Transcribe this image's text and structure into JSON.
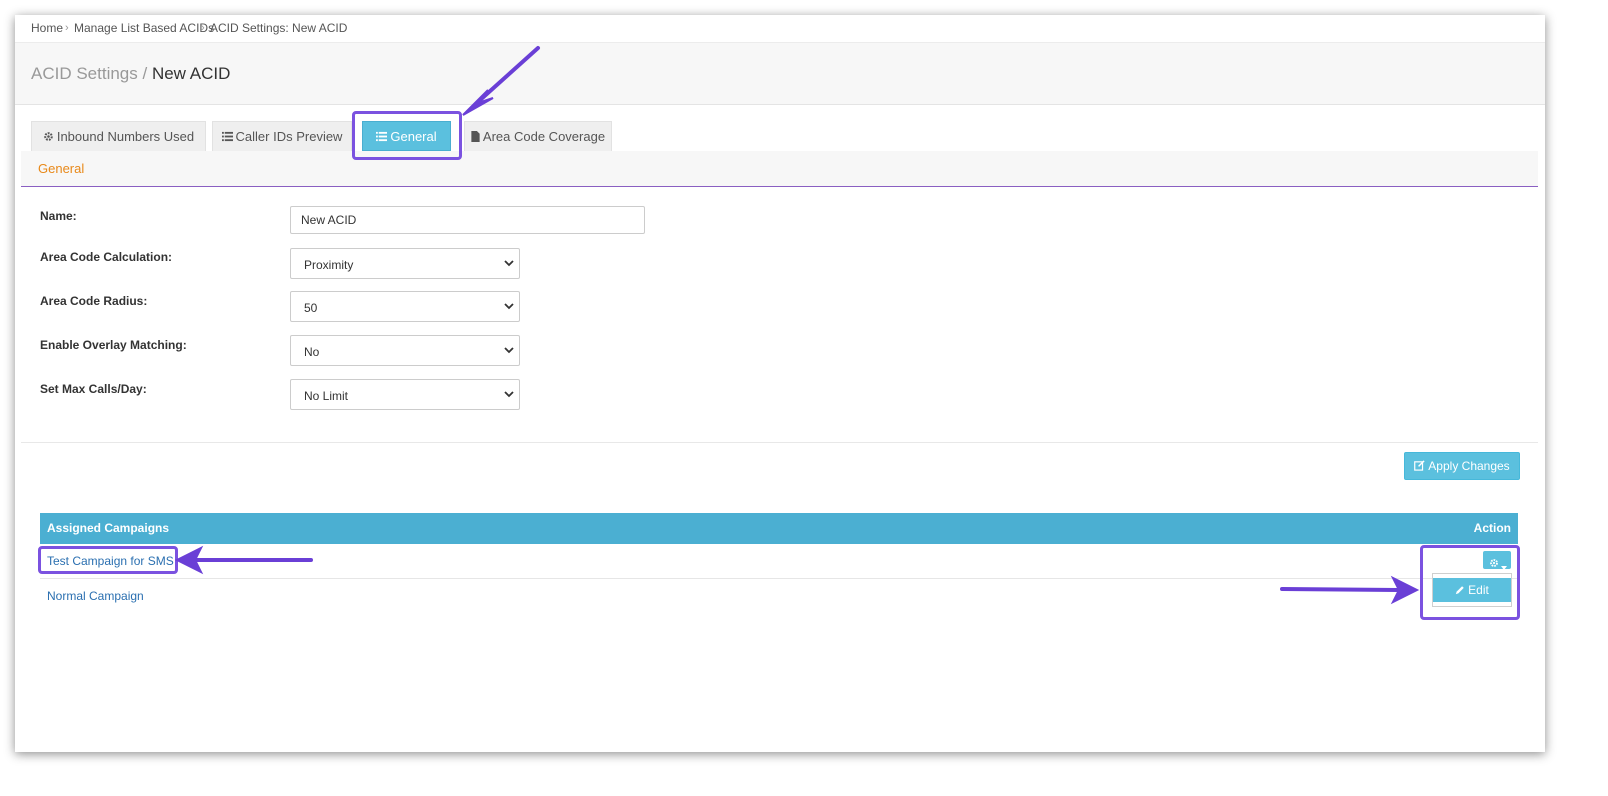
{
  "breadcrumb": {
    "items": [
      {
        "label": "Home"
      },
      {
        "label": "Manage List Based ACIDs"
      },
      {
        "label": "ACID Settings: New ACID"
      }
    ],
    "separator": "›"
  },
  "page_title": {
    "section": "ACID Settings /",
    "name": "New ACID"
  },
  "tabs": [
    {
      "label": "Inbound Numbers Used",
      "icon": "gear-icon",
      "active": false
    },
    {
      "label": "Caller IDs Preview",
      "icon": "list-icon",
      "active": false
    },
    {
      "label": "General",
      "icon": "list-icon",
      "active": true
    },
    {
      "label": "Area Code Coverage",
      "icon": "file-icon",
      "active": false
    }
  ],
  "section_title": "General",
  "form": {
    "name": {
      "label": "Name:",
      "value": "New ACID"
    },
    "area_code_calculation": {
      "label": "Area Code Calculation:",
      "value": "Proximity"
    },
    "area_code_radius": {
      "label": "Area Code Radius:",
      "value": "50"
    },
    "enable_overlay_matching": {
      "label": "Enable Overlay Matching:",
      "value": "No"
    },
    "set_max_calls_day": {
      "label": "Set Max Calls/Day:",
      "value": "No Limit"
    }
  },
  "apply_button": {
    "label": "Apply Changes",
    "icon": "edit-icon"
  },
  "campaigns_table": {
    "headers": {
      "campaigns": "Assigned Campaigns",
      "action": "Action"
    },
    "rows": [
      {
        "name": "Test Campaign for SMS"
      },
      {
        "name": "Normal Campaign"
      }
    ],
    "action_menu": {
      "icon": "gear-icon",
      "edit_label": "Edit",
      "edit_icon": "pencil-icon"
    }
  },
  "colors": {
    "accent": "#5bc0de",
    "table_header": "#4bafd2",
    "section_title": "#e8891a",
    "link": "#2a6fb0",
    "annotation": "#7b52e0"
  }
}
